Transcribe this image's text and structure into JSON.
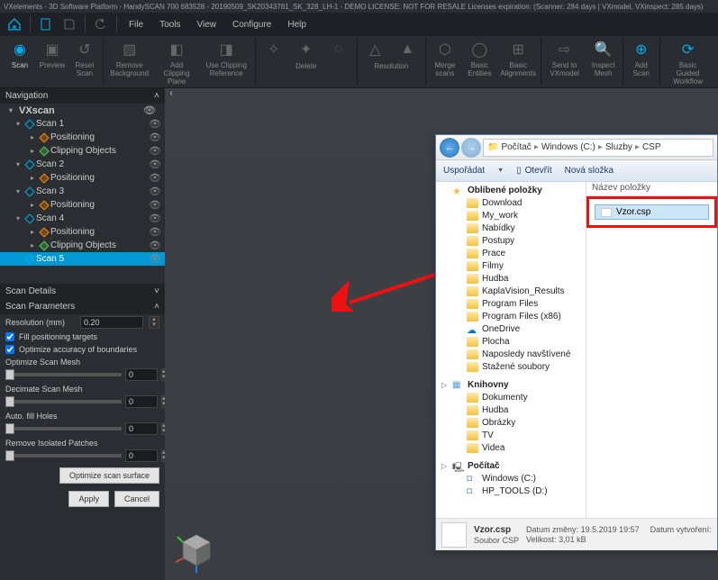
{
  "titlebar": "VXelements - 3D Software Platform - HandySCAN 700 683528 - 20190509_SK20343781_SK_328_LH-1 - DEMO LICENSE: NOT FOR RESALE Licenses expiration: (Scanner: 284 days | VXmodel, VXinspect: 285 days)",
  "menu": {
    "file": "File",
    "tools": "Tools",
    "view": "View",
    "configure": "Configure",
    "help": "Help"
  },
  "ribbon": {
    "scan": "Scan",
    "preview": "Preview",
    "reset": "Reset Scan",
    "removebg": "Remove Background",
    "addclip": "Add Clipping Plane",
    "useclip": "Use Clipping Reference",
    "delete_group": "Delete",
    "resolution_group": "Resolution",
    "merge": "Merge scans",
    "basicent": "Basic Entities",
    "basicalign": "Basic Alignments",
    "sendvx": "Send to VXmodel",
    "inspect": "Inspect Mesh",
    "addscan": "Add Scan",
    "guided": "Basic Guided Workflow"
  },
  "nav": {
    "title": "Navigation",
    "root": "VXscan",
    "items": [
      {
        "label": "Scan 1",
        "children": [
          "Positioning",
          "Clipping Objects"
        ]
      },
      {
        "label": "Scan 2",
        "children": [
          "Positioning"
        ]
      },
      {
        "label": "Scan 3",
        "children": [
          "Positioning"
        ]
      },
      {
        "label": "Scan 4",
        "children": [
          "Positioning",
          "Clipping Objects"
        ]
      },
      {
        "label": "Scan 5",
        "selected": true
      }
    ]
  },
  "details": {
    "title": "Scan Details"
  },
  "params": {
    "title": "Scan Parameters",
    "resolution_lbl": "Resolution (mm)",
    "resolution_val": "0.20",
    "fill_targets": "Fill positioning targets",
    "opt_boundaries": "Optimize accuracy of boundaries",
    "opt_mesh": "Optimize Scan Mesh",
    "opt_mesh_val": "0",
    "decimate": "Decimate Scan Mesh",
    "decimate_val": "0",
    "fill_holes": "Auto. fill Holes",
    "fill_holes_val": "0",
    "remove_iso": "Remove Isolated Patches",
    "remove_iso_val": "0",
    "opt_surface": "Optimize scan surface",
    "apply": "Apply",
    "cancel": "Cancel"
  },
  "dialog": {
    "crumbs": [
      "Počítač",
      "Windows (C:)",
      "Sluzby",
      "CSP"
    ],
    "toolbar": {
      "organize": "Uspořádat",
      "open": "Otevřít",
      "newfolder": "Nová složka"
    },
    "fav_header": "Oblíbené položky",
    "tree_fav": [
      "Download",
      "My_work",
      "Nabídky",
      "Postupy",
      "Prace",
      "Filmy",
      "Hudba",
      "KaplaVision_Results",
      "Program Files",
      "Program Files (x86)",
      "OneDrive",
      "Plocha",
      "Naposledy navštívené",
      "Stažené soubory"
    ],
    "lib_header": "Knihovny",
    "tree_lib": [
      "Dokumenty",
      "Hudba",
      "Obrázky",
      "TV",
      "Videa"
    ],
    "pc_header": "Počítač",
    "tree_pc": [
      "Windows (C:)",
      "HP_TOOLS (D:)"
    ],
    "list_header": "Název položky",
    "file": "Vzor.csp",
    "status": {
      "name": "Vzor.csp",
      "type": "Soubor CSP",
      "date_lbl": "Datum změny:",
      "date": "19.5.2019 19:57",
      "size_lbl": "Velikost:",
      "size": "3,01 kB",
      "created_lbl": "Datum vytvoření:"
    }
  }
}
